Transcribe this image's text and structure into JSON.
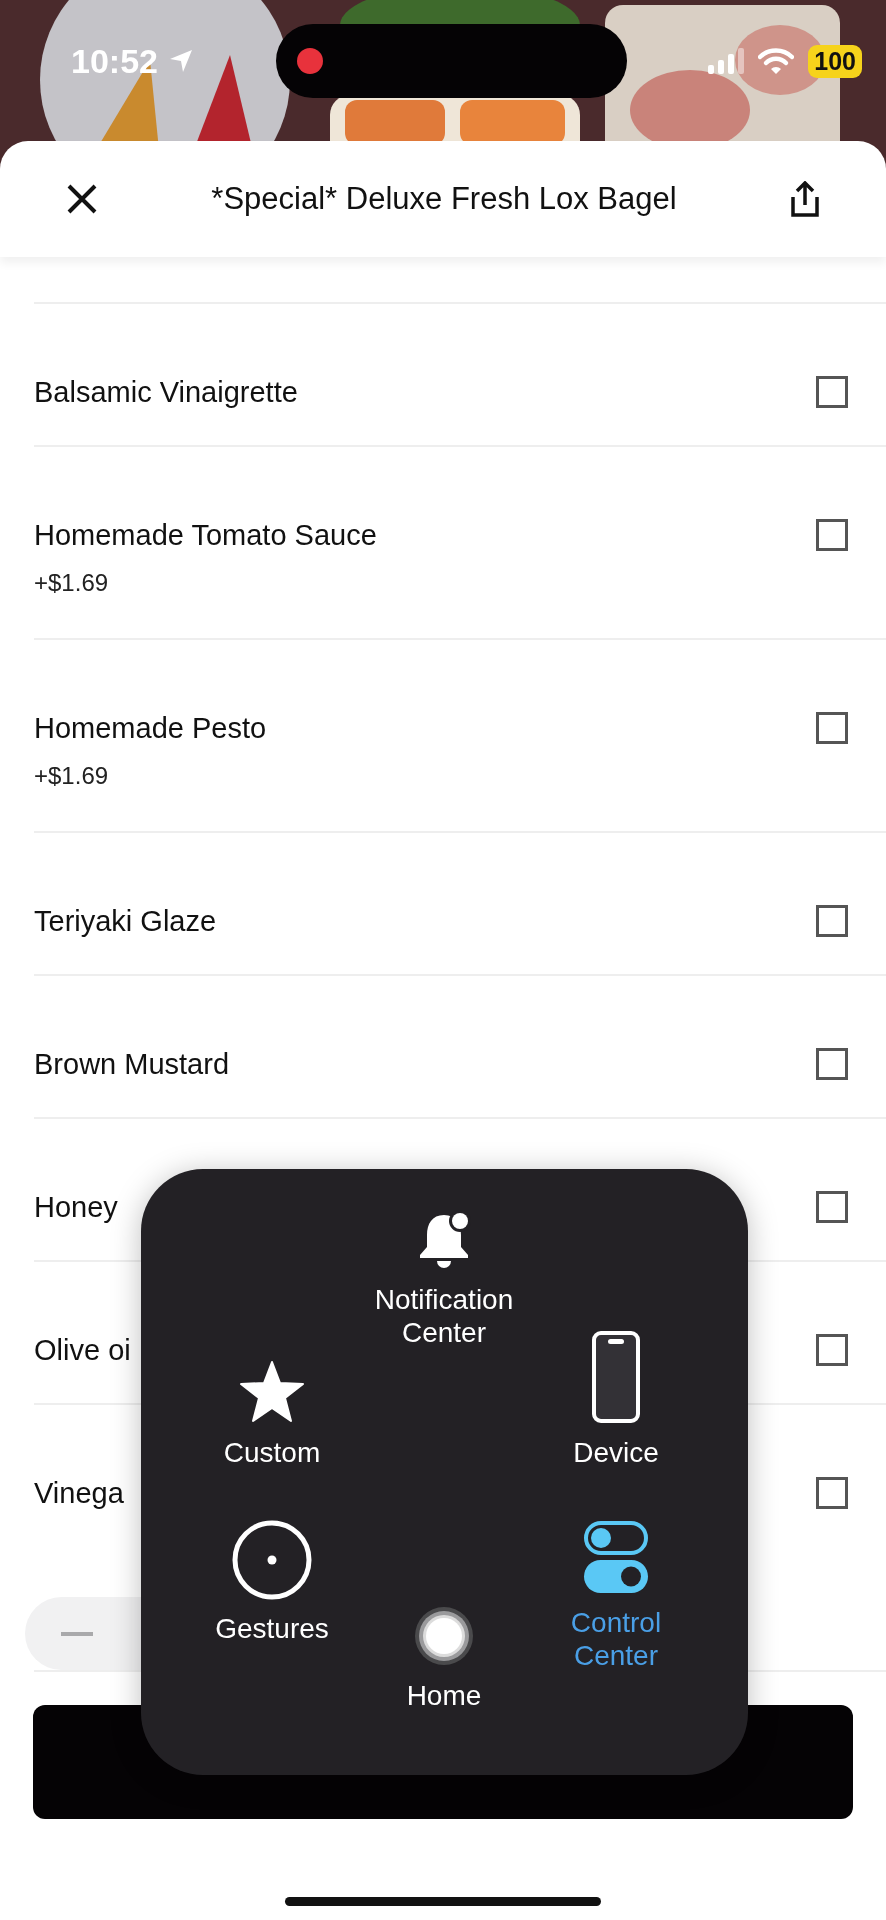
{
  "status_bar": {
    "time": "10:52",
    "battery": "100"
  },
  "header": {
    "title": "*Special* Deluxe Fresh Lox Bagel"
  },
  "options": [
    {
      "name": "Balsamic Vinaigrette",
      "checked": false
    },
    {
      "name": "Homemade Tomato Sauce",
      "price": "+$1.69",
      "checked": false
    },
    {
      "name": "Homemade Pesto",
      "price": "+$1.69",
      "checked": false
    },
    {
      "name": "Teriyaki Glaze",
      "checked": false
    },
    {
      "name": "Brown Mustard",
      "checked": false
    },
    {
      "name": "Honey",
      "checked": false
    },
    {
      "name": "Olive oi",
      "checked": false
    },
    {
      "name": "Vinega",
      "checked": false
    }
  ],
  "assistive_menu": {
    "items": [
      {
        "label": "Notification Center",
        "kind": "notification",
        "selected": false
      },
      {
        "label": "Custom",
        "kind": "custom",
        "selected": false
      },
      {
        "label": "Device",
        "kind": "device",
        "selected": false
      },
      {
        "label": "Gestures",
        "kind": "gestures",
        "selected": false
      },
      {
        "label": "Control Center",
        "kind": "control",
        "selected": true
      },
      {
        "label": "Home",
        "kind": "home",
        "selected": false
      }
    ]
  }
}
